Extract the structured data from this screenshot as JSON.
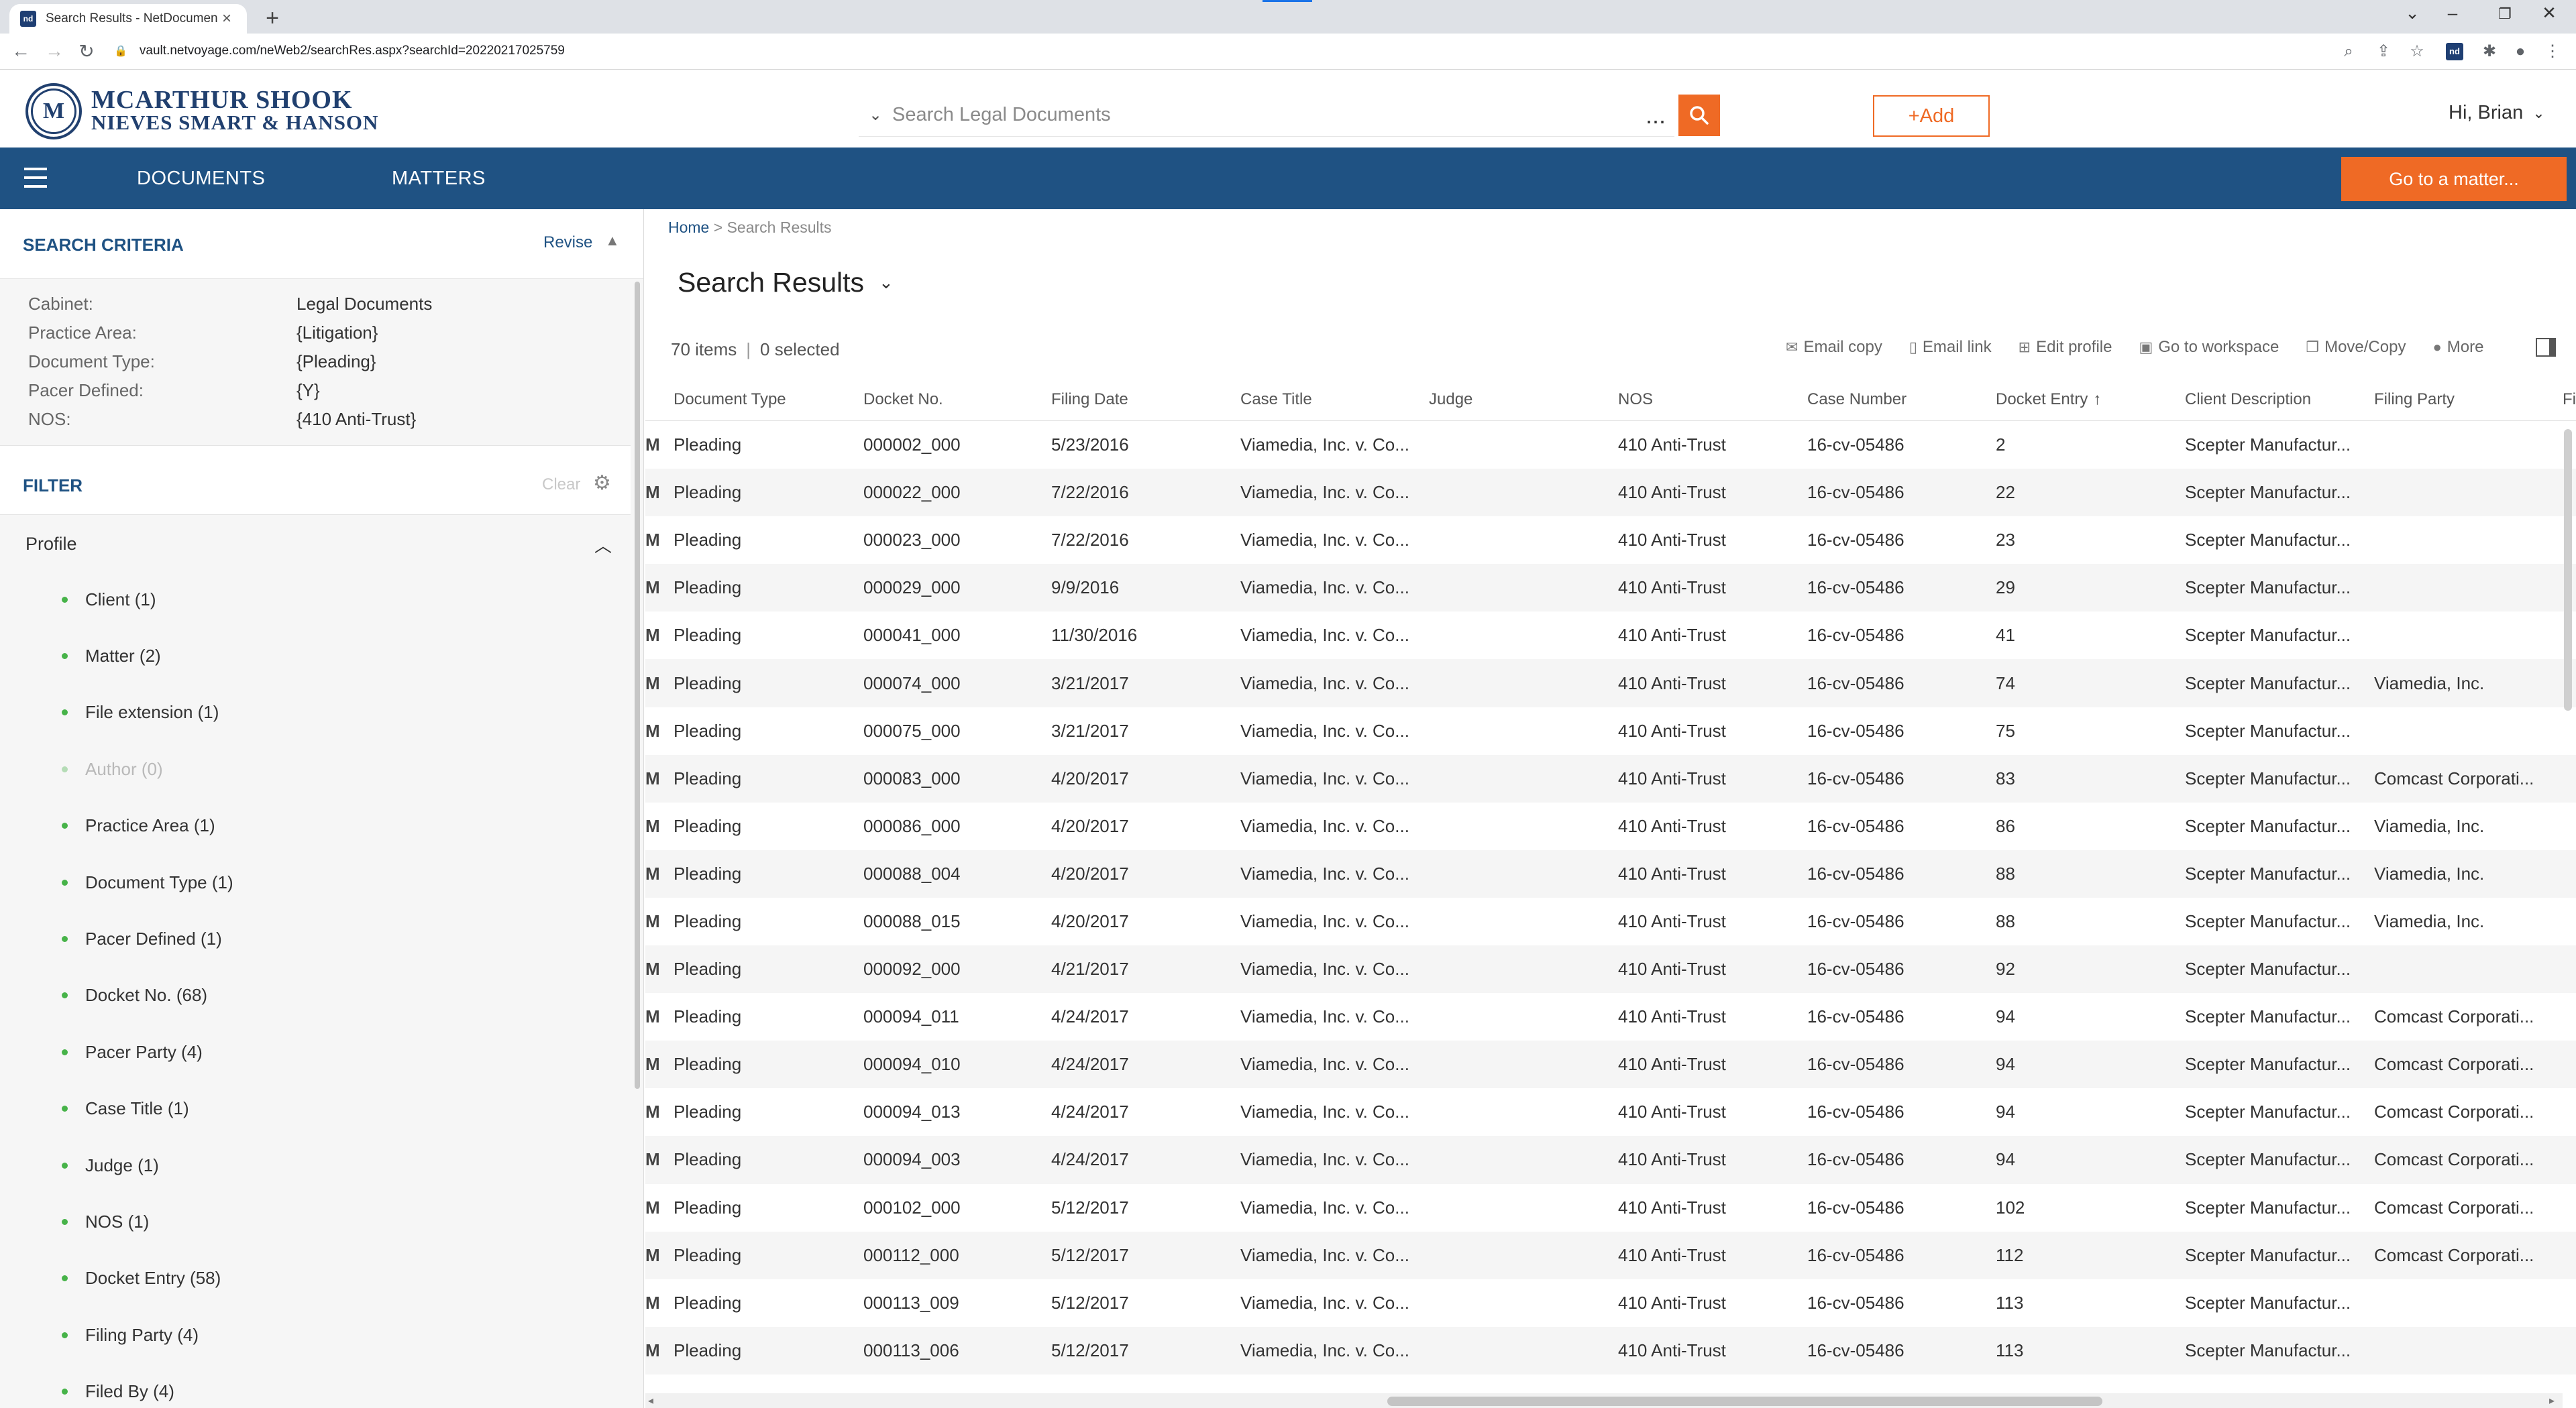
{
  "browser": {
    "tab_title": "Search Results - NetDocuments",
    "favicon": "nd",
    "url": "vault.netvoyage.com/neWeb2/searchRes.aspx?searchId=20220217025759",
    "new_tab": "+"
  },
  "header": {
    "firm_line1": "MCARTHUR SHOOK",
    "firm_line2": "NIEVES SMART & HANSON",
    "logo_mark": "M",
    "search_placeholder": "Search Legal Documents",
    "search_more": "...",
    "add_label": "+Add",
    "greeting": "Hi, Brian"
  },
  "nav": {
    "documents": "DOCUMENTS",
    "matters": "MATTERS",
    "goto_matter": "Go to a matter..."
  },
  "criteria": {
    "title": "SEARCH CRITERIA",
    "revise": "Revise",
    "rows": [
      {
        "key": "Cabinet:",
        "value": "Legal Documents"
      },
      {
        "key": "Practice Area:",
        "value": "{Litigation}"
      },
      {
        "key": "Document Type:",
        "value": "{Pleading}"
      },
      {
        "key": "Pacer Defined:",
        "value": "{Y}"
      },
      {
        "key": "NOS:",
        "value": "{410 Anti-Trust}"
      }
    ]
  },
  "filter": {
    "title": "FILTER",
    "clear": "Clear",
    "group": "Profile",
    "facets": [
      "Client (1)",
      "Matter (2)",
      "File extension (1)",
      "Author (0)",
      "Practice Area (1)",
      "Document Type (1)",
      "Pacer Defined (1)",
      "Docket No. (68)",
      "Pacer Party (4)",
      "Case Title (1)",
      "Judge (1)",
      "NOS (1)",
      "Docket Entry (58)",
      "Filing Party (4)",
      "Filed By (4)"
    ]
  },
  "main": {
    "breadcrumb_home": "Home",
    "breadcrumb_sep": " > ",
    "breadcrumb_current": "Search Results",
    "title": "Search Results",
    "items": "70 items",
    "selected": "0 selected",
    "actions": {
      "email_copy": "Email copy",
      "email_link": "Email link",
      "edit_profile": "Edit profile",
      "go_to_workspace": "Go to workspace",
      "move_copy": "Move/Copy",
      "more": "More"
    }
  },
  "table": {
    "headers": {
      "doc_type": "Document Type",
      "docket_no": "Docket No.",
      "filing_date": "Filing Date",
      "case_title": "Case Title",
      "judge": "Judge",
      "nos": "NOS",
      "case_number": "Case Number",
      "docket_entry": "Docket Entry",
      "client_description": "Client Description",
      "filing_party": "Filing Party",
      "more": "Fi"
    },
    "row_edge": "M",
    "rows": [
      {
        "type": "Pleading",
        "docket": "000002_000",
        "date": "5/23/2016",
        "case": "Viamedia, Inc. v. Co...",
        "judge": "",
        "nos": "410 Anti-Trust",
        "casenum": "16-cv-05486",
        "entry": "2",
        "client": "Scepter Manufactur...",
        "party": ""
      },
      {
        "type": "Pleading",
        "docket": "000022_000",
        "date": "7/22/2016",
        "case": "Viamedia, Inc. v. Co...",
        "judge": "",
        "nos": "410 Anti-Trust",
        "casenum": "16-cv-05486",
        "entry": "22",
        "client": "Scepter Manufactur...",
        "party": ""
      },
      {
        "type": "Pleading",
        "docket": "000023_000",
        "date": "7/22/2016",
        "case": "Viamedia, Inc. v. Co...",
        "judge": "",
        "nos": "410 Anti-Trust",
        "casenum": "16-cv-05486",
        "entry": "23",
        "client": "Scepter Manufactur...",
        "party": ""
      },
      {
        "type": "Pleading",
        "docket": "000029_000",
        "date": "9/9/2016",
        "case": "Viamedia, Inc. v. Co...",
        "judge": "",
        "nos": "410 Anti-Trust",
        "casenum": "16-cv-05486",
        "entry": "29",
        "client": "Scepter Manufactur...",
        "party": ""
      },
      {
        "type": "Pleading",
        "docket": "000041_000",
        "date": "11/30/2016",
        "case": "Viamedia, Inc. v. Co...",
        "judge": "",
        "nos": "410 Anti-Trust",
        "casenum": "16-cv-05486",
        "entry": "41",
        "client": "Scepter Manufactur...",
        "party": ""
      },
      {
        "type": "Pleading",
        "docket": "000074_000",
        "date": "3/21/2017",
        "case": "Viamedia, Inc. v. Co...",
        "judge": "",
        "nos": "410 Anti-Trust",
        "casenum": "16-cv-05486",
        "entry": "74",
        "client": "Scepter Manufactur...",
        "party": "Viamedia, Inc."
      },
      {
        "type": "Pleading",
        "docket": "000075_000",
        "date": "3/21/2017",
        "case": "Viamedia, Inc. v. Co...",
        "judge": "",
        "nos": "410 Anti-Trust",
        "casenum": "16-cv-05486",
        "entry": "75",
        "client": "Scepter Manufactur...",
        "party": ""
      },
      {
        "type": "Pleading",
        "docket": "000083_000",
        "date": "4/20/2017",
        "case": "Viamedia, Inc. v. Co...",
        "judge": "",
        "nos": "410 Anti-Trust",
        "casenum": "16-cv-05486",
        "entry": "83",
        "client": "Scepter Manufactur...",
        "party": "Comcast Corporati..."
      },
      {
        "type": "Pleading",
        "docket": "000086_000",
        "date": "4/20/2017",
        "case": "Viamedia, Inc. v. Co...",
        "judge": "",
        "nos": "410 Anti-Trust",
        "casenum": "16-cv-05486",
        "entry": "86",
        "client": "Scepter Manufactur...",
        "party": "Viamedia, Inc."
      },
      {
        "type": "Pleading",
        "docket": "000088_004",
        "date": "4/20/2017",
        "case": "Viamedia, Inc. v. Co...",
        "judge": "",
        "nos": "410 Anti-Trust",
        "casenum": "16-cv-05486",
        "entry": "88",
        "client": "Scepter Manufactur...",
        "party": "Viamedia, Inc."
      },
      {
        "type": "Pleading",
        "docket": "000088_015",
        "date": "4/20/2017",
        "case": "Viamedia, Inc. v. Co...",
        "judge": "",
        "nos": "410 Anti-Trust",
        "casenum": "16-cv-05486",
        "entry": "88",
        "client": "Scepter Manufactur...",
        "party": "Viamedia, Inc."
      },
      {
        "type": "Pleading",
        "docket": "000092_000",
        "date": "4/21/2017",
        "case": "Viamedia, Inc. v. Co...",
        "judge": "",
        "nos": "410 Anti-Trust",
        "casenum": "16-cv-05486",
        "entry": "92",
        "client": "Scepter Manufactur...",
        "party": ""
      },
      {
        "type": "Pleading",
        "docket": "000094_011",
        "date": "4/24/2017",
        "case": "Viamedia, Inc. v. Co...",
        "judge": "",
        "nos": "410 Anti-Trust",
        "casenum": "16-cv-05486",
        "entry": "94",
        "client": "Scepter Manufactur...",
        "party": "Comcast Corporati..."
      },
      {
        "type": "Pleading",
        "docket": "000094_010",
        "date": "4/24/2017",
        "case": "Viamedia, Inc. v. Co...",
        "judge": "",
        "nos": "410 Anti-Trust",
        "casenum": "16-cv-05486",
        "entry": "94",
        "client": "Scepter Manufactur...",
        "party": "Comcast Corporati..."
      },
      {
        "type": "Pleading",
        "docket": "000094_013",
        "date": "4/24/2017",
        "case": "Viamedia, Inc. v. Co...",
        "judge": "",
        "nos": "410 Anti-Trust",
        "casenum": "16-cv-05486",
        "entry": "94",
        "client": "Scepter Manufactur...",
        "party": "Comcast Corporati..."
      },
      {
        "type": "Pleading",
        "docket": "000094_003",
        "date": "4/24/2017",
        "case": "Viamedia, Inc. v. Co...",
        "judge": "",
        "nos": "410 Anti-Trust",
        "casenum": "16-cv-05486",
        "entry": "94",
        "client": "Scepter Manufactur...",
        "party": "Comcast Corporati..."
      },
      {
        "type": "Pleading",
        "docket": "000102_000",
        "date": "5/12/2017",
        "case": "Viamedia, Inc. v. Co...",
        "judge": "",
        "nos": "410 Anti-Trust",
        "casenum": "16-cv-05486",
        "entry": "102",
        "client": "Scepter Manufactur...",
        "party": "Comcast Corporati..."
      },
      {
        "type": "Pleading",
        "docket": "000112_000",
        "date": "5/12/2017",
        "case": "Viamedia, Inc. v. Co...",
        "judge": "",
        "nos": "410 Anti-Trust",
        "casenum": "16-cv-05486",
        "entry": "112",
        "client": "Scepter Manufactur...",
        "party": "Comcast Corporati..."
      },
      {
        "type": "Pleading",
        "docket": "000113_009",
        "date": "5/12/2017",
        "case": "Viamedia, Inc. v. Co...",
        "judge": "",
        "nos": "410 Anti-Trust",
        "casenum": "16-cv-05486",
        "entry": "113",
        "client": "Scepter Manufactur...",
        "party": ""
      },
      {
        "type": "Pleading",
        "docket": "000113_006",
        "date": "5/12/2017",
        "case": "Viamedia, Inc. v. Co...",
        "judge": "",
        "nos": "410 Anti-Trust",
        "casenum": "16-cv-05486",
        "entry": "113",
        "client": "Scepter Manufactur...",
        "party": ""
      }
    ]
  },
  "colors": {
    "brand_blue": "#1f5283",
    "accent_orange": "#ef6a25",
    "facet_green": "#47b349"
  },
  "icons": {
    "search": "search-icon",
    "menu": "hamburger-icon",
    "gear": "gear-icon",
    "sort": "sort-ascending-icon"
  }
}
